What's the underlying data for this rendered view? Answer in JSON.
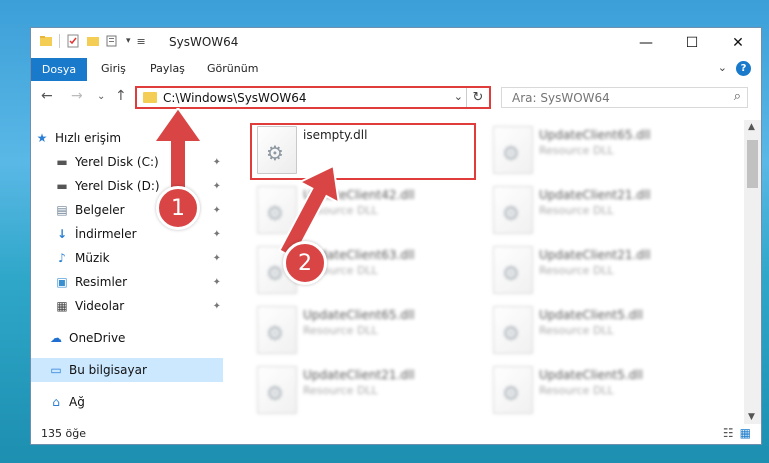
{
  "window": {
    "title": "SysWOW64"
  },
  "window_controls": {
    "minimize": "—",
    "maximize": "☐",
    "close": "✕"
  },
  "ribbon": {
    "file_tab": "Dosya",
    "tabs": [
      "Giriş",
      "Paylaş",
      "Görünüm"
    ],
    "collapse": "⌄",
    "help": "?"
  },
  "nav": {
    "back": "←",
    "forward": "→",
    "recent": "⌄",
    "up": "↑",
    "address": "C:\\Windows\\SysWOW64",
    "address_dropdown": "⌄",
    "refresh": "↻",
    "search_placeholder": "Ara: SysWOW64",
    "search_icon": "⌕"
  },
  "sidebar": {
    "items": [
      {
        "label": "Hızlı erişim",
        "icon": "★",
        "pinned": false
      },
      {
        "label": "Yerel Disk (C:)",
        "icon": "▬",
        "pinned": true
      },
      {
        "label": "Yerel Disk (D:)",
        "icon": "▬",
        "pinned": true
      },
      {
        "label": "Belgeler",
        "icon": "▤",
        "pinned": true
      },
      {
        "label": "İndirmeler",
        "icon": "↓",
        "pinned": true
      },
      {
        "label": "Müzik",
        "icon": "♪",
        "pinned": true
      },
      {
        "label": "Resimler",
        "icon": "▣",
        "pinned": true
      },
      {
        "label": "Videolar",
        "icon": "▦",
        "pinned": true
      },
      {
        "label": "OneDrive",
        "icon": "☁",
        "pinned": false
      },
      {
        "label": "Bu bilgisayar",
        "icon": "▭",
        "pinned": false
      },
      {
        "label": "Ağ",
        "icon": "⌂",
        "pinned": false
      }
    ],
    "pin_glyph": "✦"
  },
  "files": [
    {
      "name": "isempty.dll",
      "desc": ""
    },
    {
      "name": "UpdateClient65.dll",
      "desc": "Resource DLL"
    },
    {
      "name": "UpdateClient42.dll",
      "desc": "Resource DLL"
    },
    {
      "name": "UpdateClient21.dll",
      "desc": "Resource DLL"
    },
    {
      "name": "UpdateClient63.dll",
      "desc": "Resource DLL"
    },
    {
      "name": "UpdateClient21.dll",
      "desc": "Resource DLL"
    },
    {
      "name": "UpdateClient65.dll",
      "desc": "Resource DLL"
    },
    {
      "name": "UpdateClient5.dll",
      "desc": "Resource DLL"
    },
    {
      "name": "UpdateClient21.dll",
      "desc": "Resource DLL"
    },
    {
      "name": "UpdateClient5.dll",
      "desc": "Resource DLL"
    }
  ],
  "status": {
    "count": "135 öğe"
  },
  "annotations": {
    "callout1": "1",
    "callout2": "2"
  },
  "colors": {
    "accent": "#1979ca",
    "highlight": "#e03c3c",
    "selection": "#cce8ff"
  }
}
